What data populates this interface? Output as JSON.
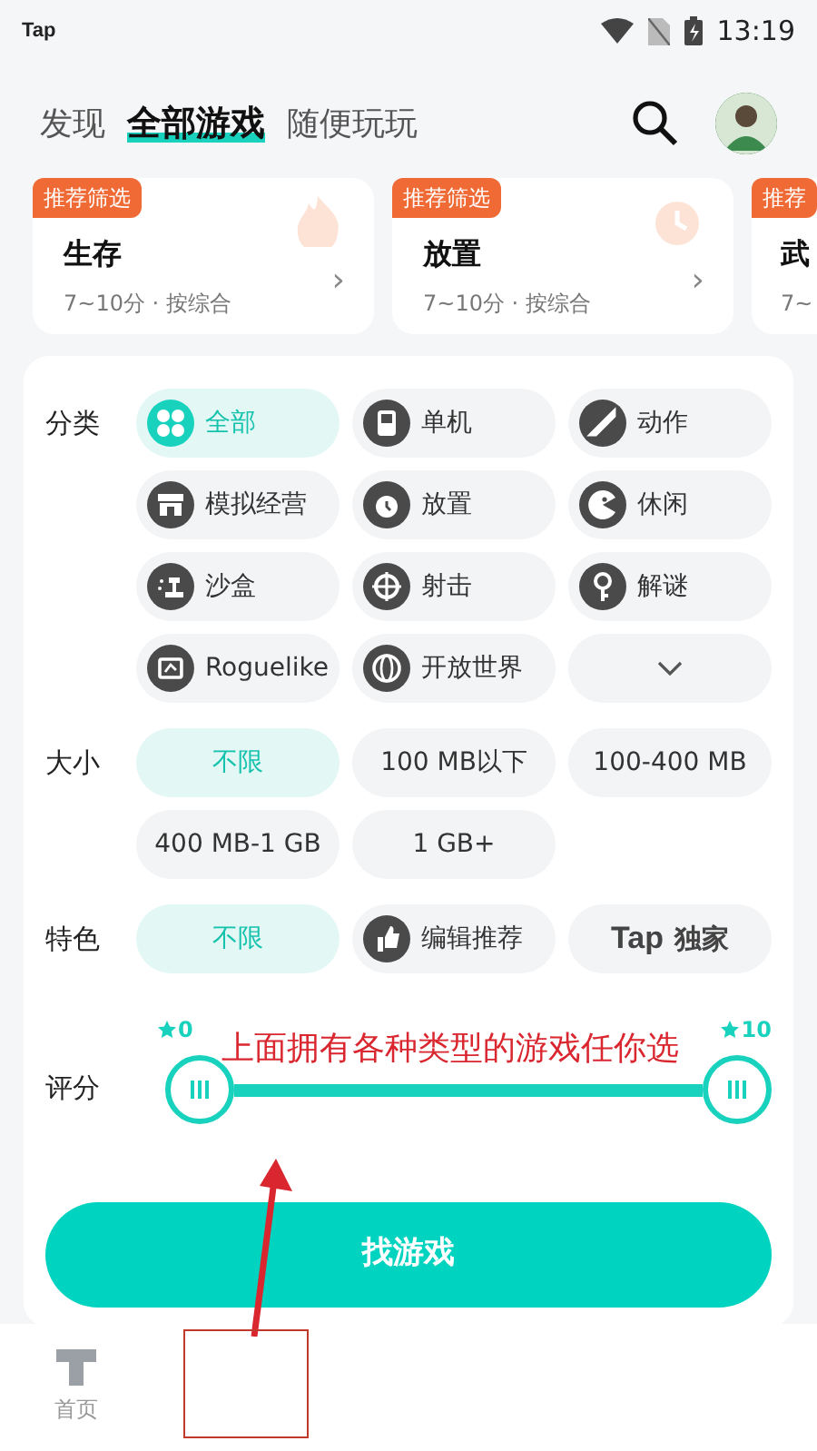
{
  "status_bar": {
    "app": "Tap",
    "time": "13:19"
  },
  "tabs": [
    {
      "label": "发现",
      "selected": false
    },
    {
      "label": "全部游戏",
      "selected": true
    },
    {
      "label": "随便玩玩",
      "selected": false
    }
  ],
  "recommend_cards": [
    {
      "badge": "推荐筛选",
      "title": "生存",
      "meta": "7~10分 · 按综合",
      "chevron": "›"
    },
    {
      "badge": "推荐筛选",
      "title": "放置",
      "meta": "7~10分 · 按综合",
      "chevron": "›"
    },
    {
      "badge": "推荐",
      "title": "武",
      "meta": "7~"
    }
  ],
  "filters": [
    {
      "label": "分类",
      "chips": [
        {
          "kind": "icon",
          "label": "全部",
          "selected": true
        },
        {
          "kind": "icon",
          "label": "单机",
          "selected": false
        },
        {
          "kind": "icon",
          "label": "动作",
          "selected": false
        },
        {
          "kind": "icon",
          "label": "模拟经营",
          "selected": false
        },
        {
          "kind": "icon",
          "label": "放置",
          "selected": false
        },
        {
          "kind": "icon",
          "label": "休闲",
          "selected": false
        },
        {
          "kind": "icon",
          "label": "沙盒",
          "selected": false
        },
        {
          "kind": "icon",
          "label": "射击",
          "selected": false
        },
        {
          "kind": "icon",
          "label": "解谜",
          "selected": false
        },
        {
          "kind": "icon",
          "label": "Roguelike",
          "selected": false
        },
        {
          "kind": "icon",
          "label": "开放世界",
          "selected": false
        },
        {
          "kind": "more",
          "selected": false
        }
      ]
    },
    {
      "label": "大小",
      "chips": [
        {
          "kind": "text",
          "label": "不限",
          "selected": true
        },
        {
          "kind": "text",
          "label": "100 MB以下",
          "selected": false
        },
        {
          "kind": "text",
          "label": "100-400 MB",
          "selected": false
        },
        {
          "kind": "text",
          "label": "400 MB-1 GB",
          "selected": false
        },
        {
          "kind": "text",
          "label": "1 GB+",
          "selected": false
        }
      ]
    },
    {
      "label": "特色",
      "chips": [
        {
          "kind": "text",
          "label": "不限",
          "selected": true
        },
        {
          "kind": "icon",
          "label": "编辑推荐",
          "selected": false
        },
        {
          "kind": "logo",
          "label": "Tap",
          "suffix": "独家",
          "selected": false
        }
      ]
    }
  ],
  "rating": {
    "label": "评分",
    "min_label": "0",
    "max_label": "10"
  },
  "annotation": "上面拥有各种类型的游戏任你选",
  "find_button": "找游戏",
  "bottom_nav": [
    {
      "label": "首页",
      "selected": false
    }
  ]
}
